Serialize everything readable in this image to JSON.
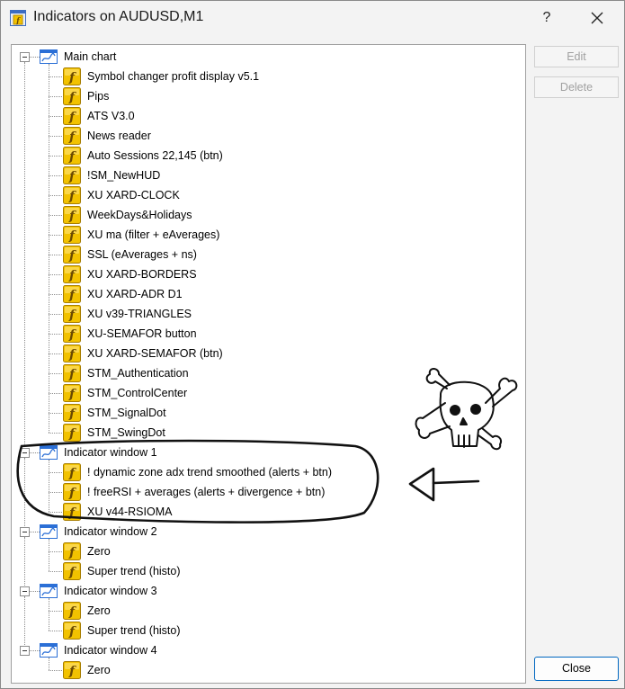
{
  "window": {
    "title": "Indicators on AUDUSD,M1",
    "help_glyph": "?"
  },
  "buttons": {
    "edit": "Edit",
    "delete": "Delete",
    "close": "Close"
  },
  "tree": [
    {
      "label": "Main chart",
      "children": [
        "Symbol changer profit display v5.1",
        "Pips",
        "ATS V3.0",
        "News reader",
        "Auto Sessions 22,145 (btn)",
        "!SM_NewHUD",
        "XU XARD-CLOCK",
        "WeekDays&Holidays",
        "XU ma (filter + eAverages)",
        "SSL (eAverages + ns)",
        "XU XARD-BORDERS",
        "XU XARD-ADR D1",
        "XU v39-TRIANGLES",
        "XU-SEMAFOR button",
        "XU XARD-SEMAFOR (btn)",
        "STM_Authentication",
        "STM_ControlCenter",
        "STM_SignalDot",
        "STM_SwingDot"
      ]
    },
    {
      "label": "Indicator window 1",
      "children": [
        "! dynamic zone adx trend smoothed (alerts + btn)",
        "! freeRSI + averages (alerts + divergence + btn)",
        "XU v44-RSIOMA"
      ]
    },
    {
      "label": "Indicator window 2",
      "children": [
        "Zero",
        "Super trend (histo)"
      ]
    },
    {
      "label": "Indicator window 3",
      "children": [
        "Zero",
        "Super trend (histo)"
      ]
    },
    {
      "label": "Indicator window 4",
      "children": [
        "Zero"
      ]
    }
  ],
  "colors": {
    "close_border": "#0067c0",
    "indicator_icon": "#f2c200",
    "window_icon": "#2b6fd6"
  }
}
